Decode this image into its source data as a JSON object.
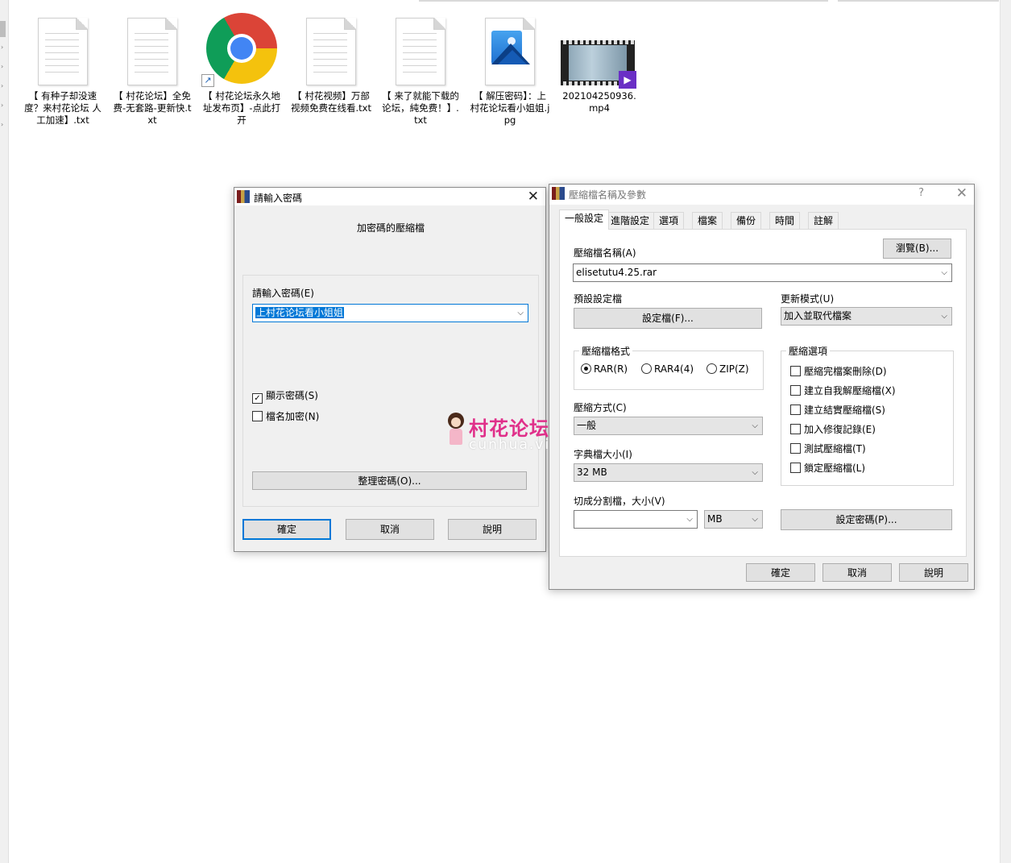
{
  "files": [
    {
      "name": "【 有种子却没速度？来村花论坛 人工加速】.txt",
      "icon": "text-file-icon"
    },
    {
      "name": "【 村花论坛】全免费-无套路-更新快.txt",
      "icon": "text-file-icon"
    },
    {
      "name": "【 村花论坛永久地址发布页】-点此打开",
      "icon": "chrome-shortcut-icon"
    },
    {
      "name": "【 村花视频】万部视频免费在线看.txt",
      "icon": "text-file-icon"
    },
    {
      "name": "【 来了就能下载的论坛，純免费！】.txt",
      "icon": "text-file-icon"
    },
    {
      "name": "【 解压密码】：上村花论坛看小姐姐.jpg",
      "icon": "image-file-icon"
    },
    {
      "name": "202104250936.mp4",
      "icon": "video-file-icon"
    }
  ],
  "password_dialog": {
    "title": "請輸入密碼",
    "subtitle": "加密碼的壓縮檔",
    "prompt_label": "請輸入密碼(E)",
    "password_value": "上村花论坛看小姐姐",
    "show_password": {
      "label": "顯示密碼(S)",
      "checked": true
    },
    "encrypt_names": {
      "label": "檔名加密(N)",
      "checked": false
    },
    "organize_button": "整理密碼(O)...",
    "ok": "確定",
    "cancel": "取消",
    "help": "說明"
  },
  "archive_dialog": {
    "title": "壓縮檔名稱及參數",
    "help_icon": "?",
    "tabs": [
      "一般設定",
      "進階設定",
      "選項",
      "檔案",
      "備份",
      "時間",
      "註解"
    ],
    "active_tab": "一般設定",
    "archive_name_label": "壓縮檔名稱(A)",
    "archive_name_value": "elisetutu4.25.rar",
    "browse_button": "瀏覽(B)...",
    "profile_label": "預設設定檔",
    "profile_button": "設定檔(F)...",
    "update_mode_label": "更新模式(U)",
    "update_mode_value": "加入並取代檔案",
    "format_group": "壓縮檔格式",
    "formats": [
      {
        "label": "RAR(R)",
        "selected": true
      },
      {
        "label": "RAR4(4)",
        "selected": false
      },
      {
        "label": "ZIP(Z)",
        "selected": false
      }
    ],
    "method_label": "壓縮方式(C)",
    "method_value": "一般",
    "dict_label": "字典檔大小(I)",
    "dict_value": "32 MB",
    "split_label": "切成分割檔，大小(V)",
    "split_value": "",
    "split_unit": "MB",
    "options_group": "壓縮選項",
    "options": [
      "壓縮完檔案刪除(D)",
      "建立自我解壓縮檔(X)",
      "建立結實壓縮檔(S)",
      "加入修復記錄(E)",
      "測試壓縮檔(T)",
      "鎖定壓縮檔(L)"
    ],
    "set_password_button": "設定密碼(P)...",
    "ok": "確定",
    "cancel": "取消",
    "help": "說明"
  },
  "watermark": {
    "text": "村花论坛",
    "sub": "cunhua.vi"
  }
}
